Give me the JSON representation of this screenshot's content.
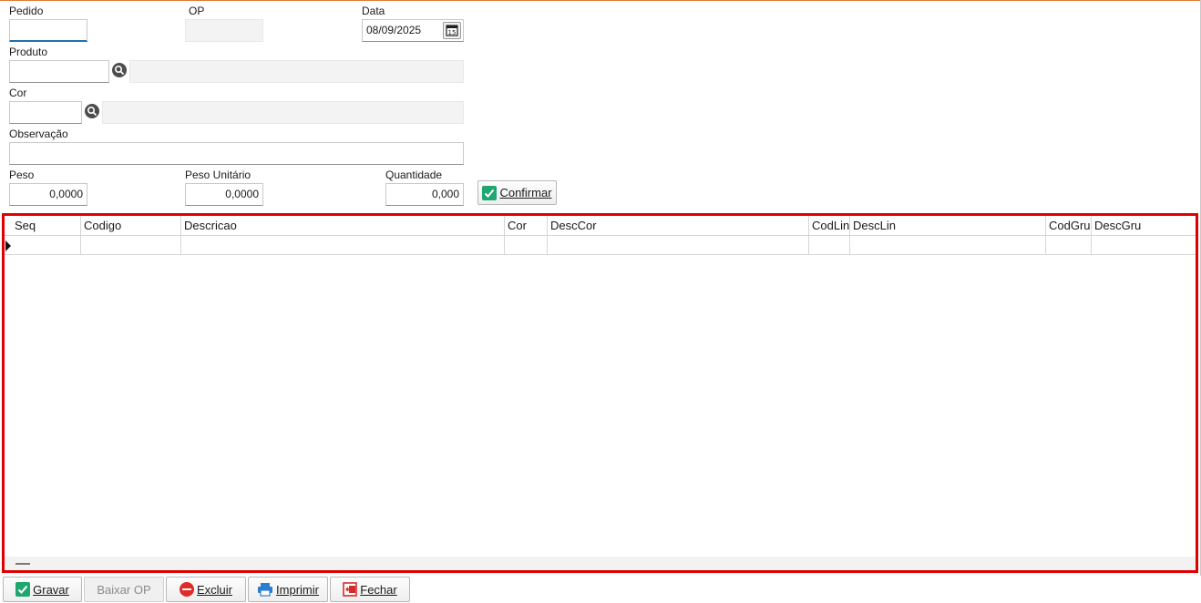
{
  "form": {
    "pedido": {
      "label": "Pedido",
      "value": ""
    },
    "op": {
      "label": "OP",
      "value": ""
    },
    "data": {
      "label": "Data",
      "value": "08/09/2025"
    },
    "produto": {
      "label": "Produto",
      "code": "",
      "description": ""
    },
    "cor": {
      "label": "Cor",
      "code": "",
      "description": ""
    },
    "observacao": {
      "label": "Observação",
      "value": ""
    },
    "peso": {
      "label": "Peso",
      "value": "0,0000"
    },
    "peso_unitario": {
      "label": "Peso Unitário",
      "value": "0,0000"
    },
    "quantidade": {
      "label": "Quantidade",
      "value": "0,000"
    },
    "confirmar_label": "Confirmar"
  },
  "grid": {
    "columns": [
      "Seq",
      "Codigo",
      "Descricao",
      "Cor",
      "DescCor",
      "CodLin",
      "DescLin",
      "CodGru",
      "DescGru"
    ],
    "rows": []
  },
  "footer": {
    "gravar": "Gravar",
    "baixar_op": "Baixar OP",
    "excluir": "Excluir",
    "imprimir": "Imprimir",
    "fechar": "Fechar"
  },
  "icons": {
    "search": "magnifier-icon",
    "calendar": "calendar-icon",
    "check": "check-icon",
    "delete": "minus-circle-icon",
    "print": "printer-icon",
    "close": "exit-door-icon"
  },
  "colors": {
    "accent_top": "#e07a3a",
    "grid_highlight": "#e00000",
    "check_green": "#1fa76f",
    "delete_red": "#e02b2b",
    "focus_blue": "#1f6fb0"
  }
}
